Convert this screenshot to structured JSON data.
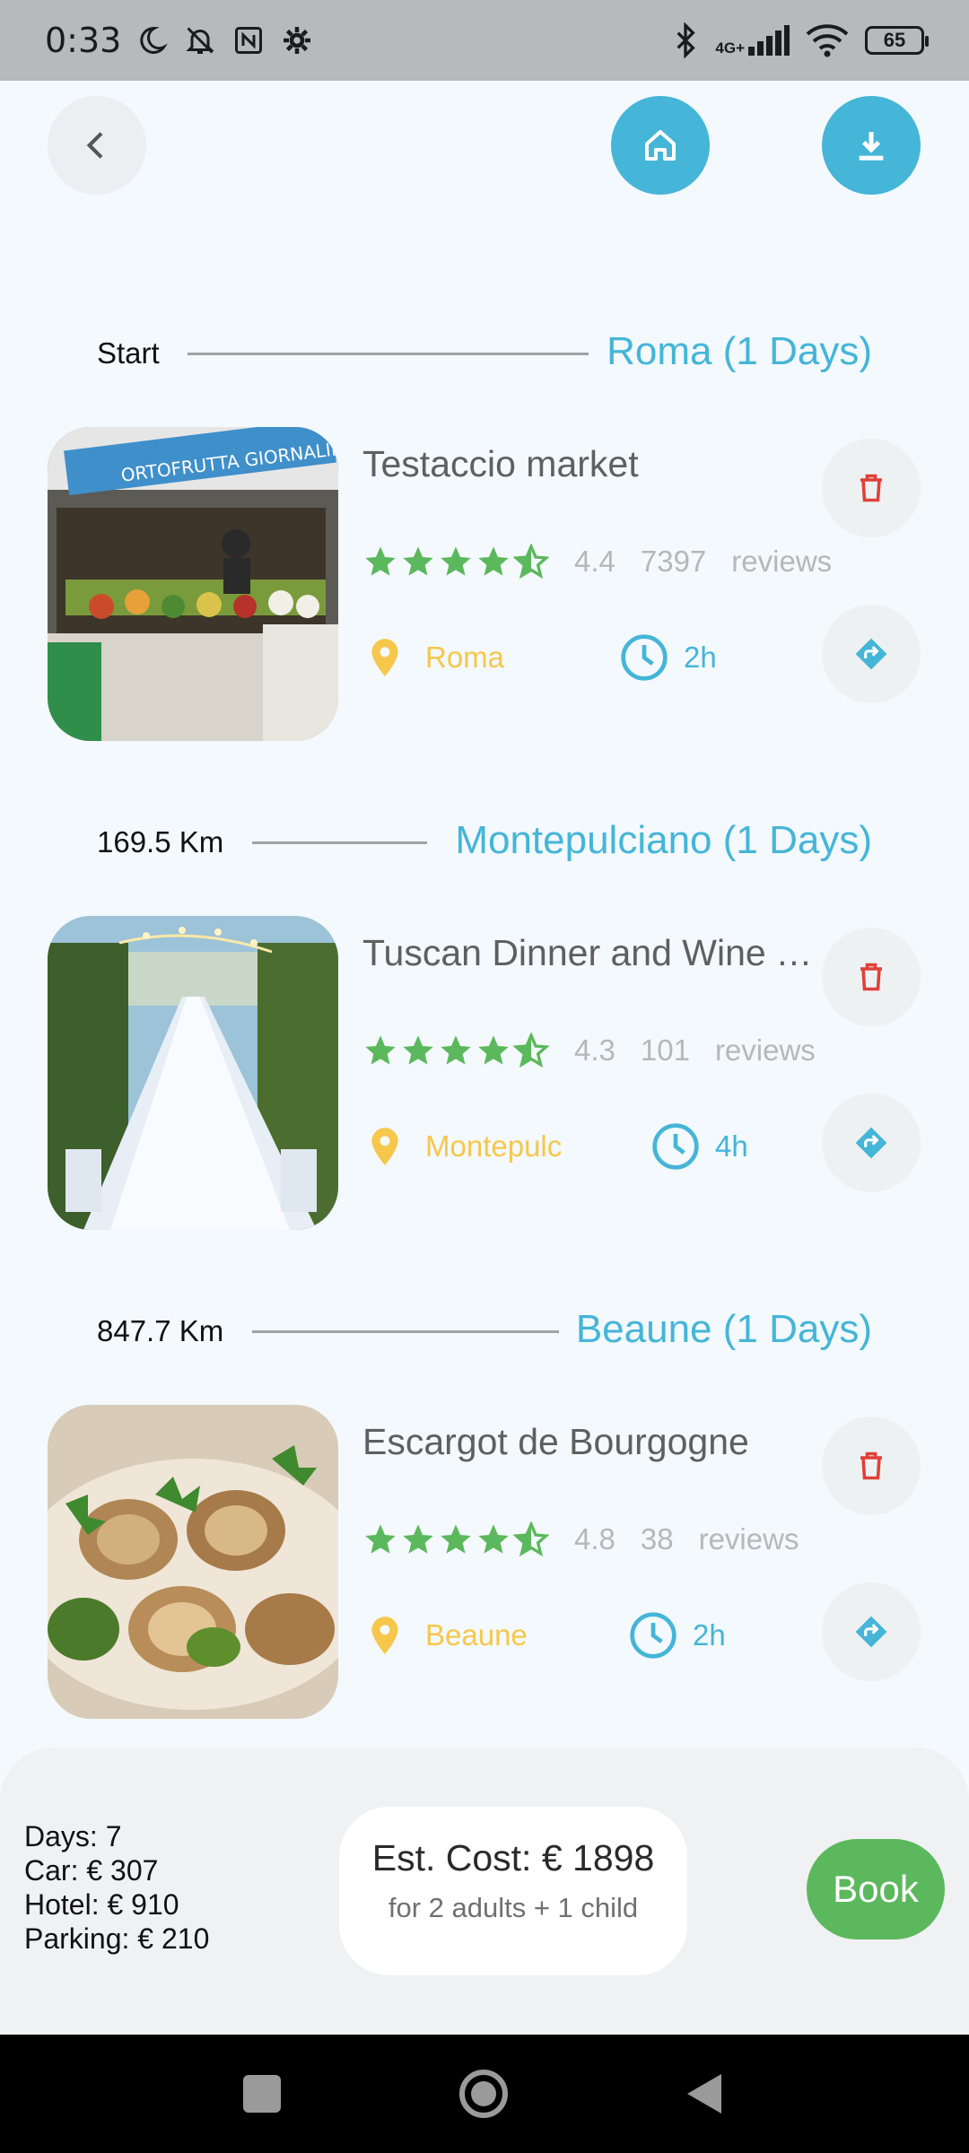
{
  "status_bar": {
    "time": "0:33",
    "network": "4G+",
    "battery": "65"
  },
  "colors": {
    "accent": "#45b5d8",
    "rating_star": "#5cb85c",
    "location": "#f7c74c",
    "delete": "#e0403a",
    "book": "#5cb85c"
  },
  "segments": [
    {
      "distance": "Start",
      "city": "Roma (1 Days)",
      "activity": {
        "title": "Testaccio market",
        "rating": "4.4",
        "review_count": "7397",
        "reviews_label": "reviews",
        "stars": 4.5,
        "location": "Roma",
        "duration": "2h",
        "image": "market-stall-photo"
      }
    },
    {
      "distance": "169.5 Km",
      "city": "Montepulciano (1 Days)",
      "activity": {
        "title": "Tuscan Dinner and Wine Tasting",
        "rating": "4.3",
        "review_count": "101",
        "reviews_label": "reviews",
        "stars": 4.5,
        "location": "Montepulc",
        "duration": "4h",
        "image": "vineyard-dinner-table-photo"
      }
    },
    {
      "distance": "847.7 Km",
      "city": "Beaune (1 Days)",
      "activity": {
        "title": "Escargot de Bourgogne",
        "rating": "4.8",
        "review_count": "38",
        "reviews_label": "reviews",
        "stars": 4.5,
        "location": "Beaune",
        "duration": "2h",
        "image": "escargot-plate-photo"
      }
    }
  ],
  "summary": {
    "days": "Days: 7",
    "car": "Car: € 307",
    "hotel": "Hotel: € 910",
    "parking": "Parking: € 210"
  },
  "cost": {
    "main": "Est. Cost: € 1898",
    "sub": "for 2 adults + 1 child"
  },
  "book_label": "Book"
}
